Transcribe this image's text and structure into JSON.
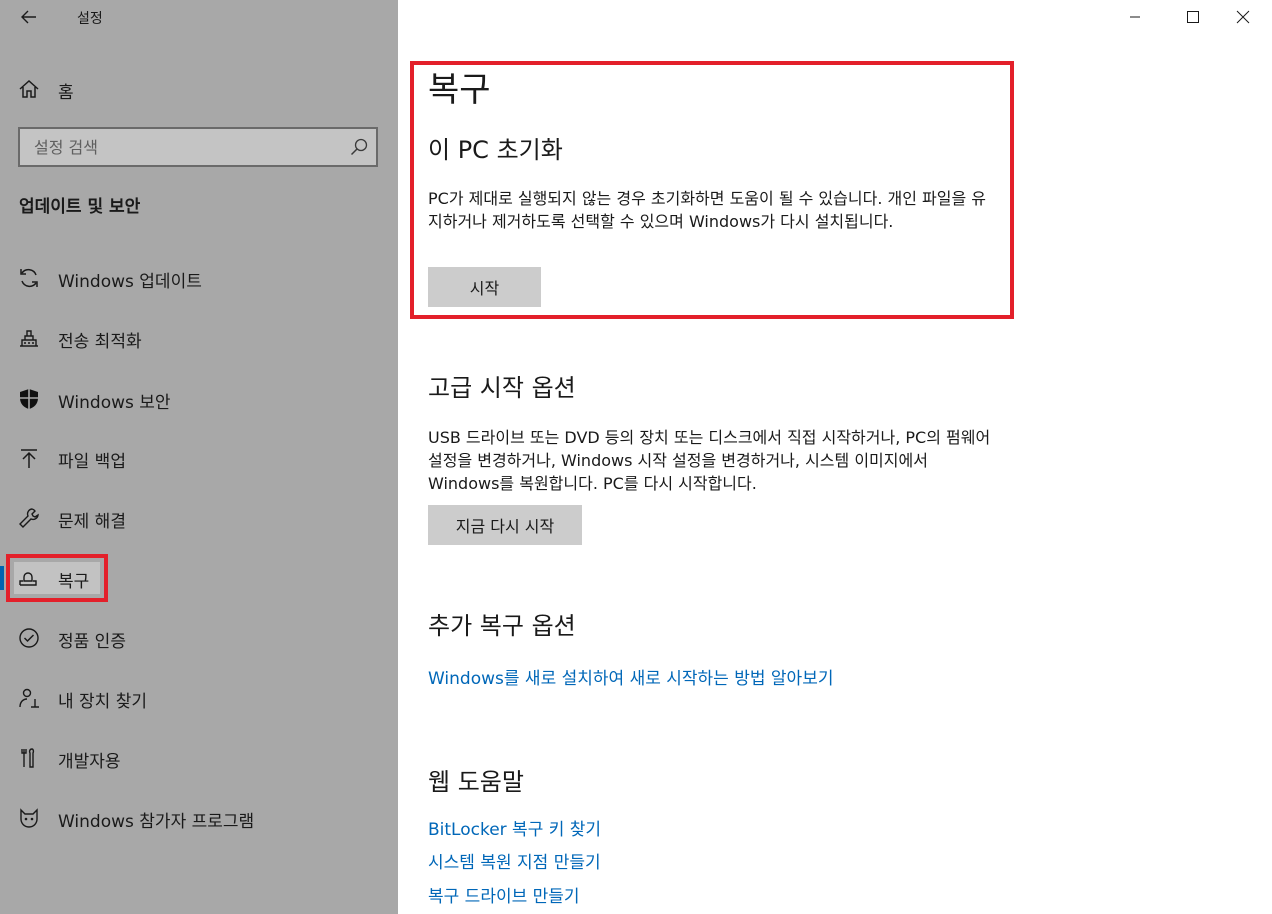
{
  "window": {
    "title": "설정"
  },
  "sidebar": {
    "home_label": "홈",
    "search_placeholder": "설정 검색",
    "section_heading": "업데이트 및 보안",
    "items": [
      {
        "label": "Windows 업데이트",
        "icon": "sync-icon"
      },
      {
        "label": "전송 최적화",
        "icon": "delivery-optimization-icon"
      },
      {
        "label": "Windows 보안",
        "icon": "shield-icon"
      },
      {
        "label": "파일 백업",
        "icon": "backup-arrow-icon"
      },
      {
        "label": "문제 해결",
        "icon": "wrench-icon"
      },
      {
        "label": "복구",
        "icon": "recovery-icon",
        "active": true
      },
      {
        "label": "정품 인증",
        "icon": "check-circle-icon"
      },
      {
        "label": "내 장치 찾기",
        "icon": "person-location-icon"
      },
      {
        "label": "개발자용",
        "icon": "developer-tools-icon"
      },
      {
        "label": "Windows 참가자 프로그램",
        "icon": "insider-cat-icon"
      }
    ]
  },
  "main": {
    "title": "복구",
    "reset": {
      "heading": "이 PC 초기화",
      "description": "PC가 제대로 실행되지 않는 경우 초기화하면 도움이 될 수 있습니다. 개인 파일을 유지하거나 제거하도록 선택할 수 있으며 Windows가 다시 설치됩니다.",
      "button": "시작"
    },
    "advanced": {
      "heading": "고급 시작 옵션",
      "description": "USB 드라이브 또는 DVD 등의 장치 또는 디스크에서 직접 시작하거나, PC의 펌웨어 설정을 변경하거나, Windows 시작 설정을 변경하거나, 시스템 이미지에서 Windows를 복원합니다. PC를 다시 시작합니다.",
      "button": "지금 다시 시작"
    },
    "more": {
      "heading": "추가 복구 옵션",
      "link": "Windows를 새로 설치하여 새로 시작하는 방법 알아보기"
    },
    "help": {
      "heading": "웹 도움말",
      "links": [
        "BitLocker 복구 키 찾기",
        "시스템 복원 지점 만들기",
        "복구 드라이브 만들기"
      ]
    }
  },
  "colors": {
    "sidebar_bg": "#a8a8a8",
    "link": "#0067b8",
    "highlight": "#e3202a",
    "accent": "#0063b1"
  }
}
